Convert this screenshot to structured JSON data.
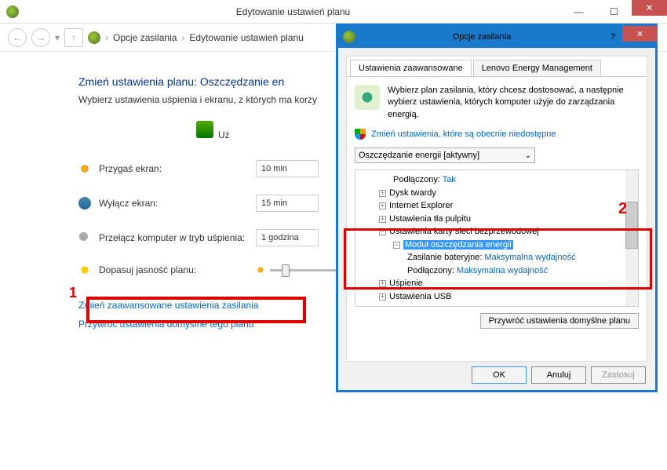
{
  "window": {
    "title": "Edytowanie ustawień planu"
  },
  "breadcrumb": {
    "item1": "Opcje zasilania",
    "item2": "Edytowanie ustawień planu"
  },
  "main": {
    "heading": "Zmień ustawienia planu: Oszczędzanie en",
    "subtitle": "Wybierz ustawienia uśpienia i ekranu, z których ma korzy",
    "col_header": "Uż",
    "rows": {
      "dim": {
        "label": "Przygaś ekran:",
        "value": "10 min"
      },
      "off": {
        "label": "Wyłącz ekran:",
        "value": "15 min"
      },
      "sleep": {
        "label": "Przełącz komputer w tryb uśpienia:",
        "value": "1 godzina"
      },
      "bright": {
        "label": "Dopasuj jasność planu:"
      }
    },
    "link_adv": "Zmień zaawansowane ustawienia zasilania",
    "link_restore": "Przywróć ustawienia domyślne tego planu"
  },
  "marker1": "1",
  "marker2": "2",
  "dialog": {
    "title": "Opcje zasilania",
    "tab1": "Ustawienia zaawansowane",
    "tab2": "Lenovo Energy Management",
    "desc": "Wybierz plan zasilania, który chcesz dostosować, a następnie wybierz ustawienia, których komputer użyje do zarządzania energią.",
    "admin_link": "Zmień ustawienia, które są obecnie niedostępne",
    "plan": "Oszczędzanie energii [aktywny]",
    "tree": {
      "n0": "Podłączony:",
      "n0v": "Tak",
      "n1": "Dysk twardy",
      "n2": "Internet Explorer",
      "n3": "Ustawienia tła pulpitu",
      "n4": "Ustawienia karty sieci bezprzewodowej",
      "n5": "Moduł oszczędzania energii",
      "n6": "Zasilanie bateryjne:",
      "n6v": "Maksymalna wydajność",
      "n7": "Podłączony:",
      "n7v": "Maksymalna wydajność",
      "n8": "Uśpienie",
      "n9": "Ustawienia USB"
    },
    "restore_btn": "Przywróć ustawienia domyślne planu",
    "ok": "OK",
    "cancel": "Anuluj",
    "apply": "Zastosuj"
  }
}
